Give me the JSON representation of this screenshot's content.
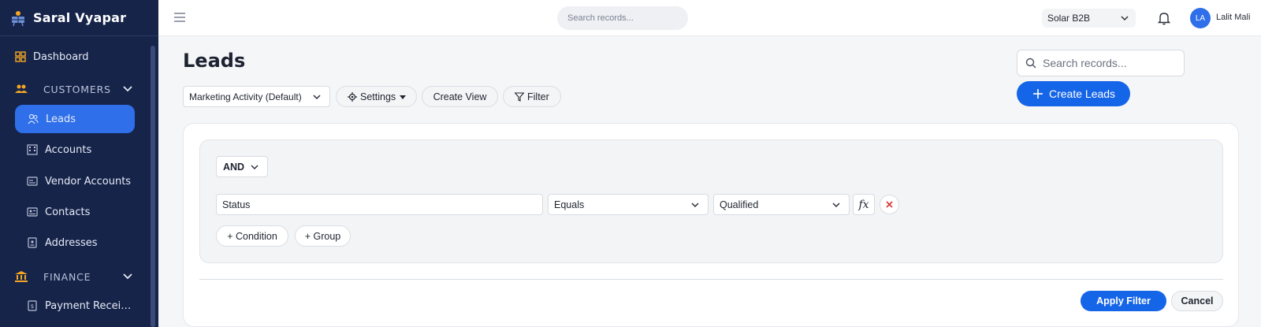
{
  "app": {
    "brand": "Saral Vyapar"
  },
  "sidebar": {
    "items": [
      {
        "label": "Dashboard",
        "icon": "dashboard-icon"
      },
      {
        "section": "CUSTOMERS",
        "icon": "customers-icon"
      },
      {
        "label": "Leads",
        "icon": "users-icon",
        "active": true
      },
      {
        "label": "Accounts",
        "icon": "building-icon"
      },
      {
        "label": "Vendor Accounts",
        "icon": "vendor-card-icon"
      },
      {
        "label": "Contacts",
        "icon": "contact-card-icon"
      },
      {
        "label": "Addresses",
        "icon": "address-icon"
      },
      {
        "section": "FINANCE",
        "icon": "bank-icon"
      },
      {
        "label": "Payment Recei…",
        "icon": "receipt-icon"
      }
    ]
  },
  "topbar": {
    "search_placeholder": "Search records...",
    "org": "Solar B2B",
    "avatar_initials": "LA",
    "user_name": "Lalit Mali"
  },
  "page": {
    "title": "Leads",
    "search_placeholder": "Search records...",
    "create_label": "Create Leads",
    "view_select": "Marketing Activity (Default)",
    "settings_label": "Settings",
    "create_view_label": "Create View",
    "filter_label": "Filter"
  },
  "filter": {
    "operator": "AND",
    "condition": {
      "field": "Status",
      "op": "Equals",
      "value": "Qualified"
    },
    "fx_label": "fx",
    "add_condition": "+ Condition",
    "add_group": "+ Group",
    "apply": "Apply Filter",
    "cancel": "Cancel"
  },
  "colors": {
    "sidebar_bg": "#16244a",
    "accent": "#1565e8",
    "active_item": "#2f6fea",
    "section_icon": "#f5a623"
  }
}
